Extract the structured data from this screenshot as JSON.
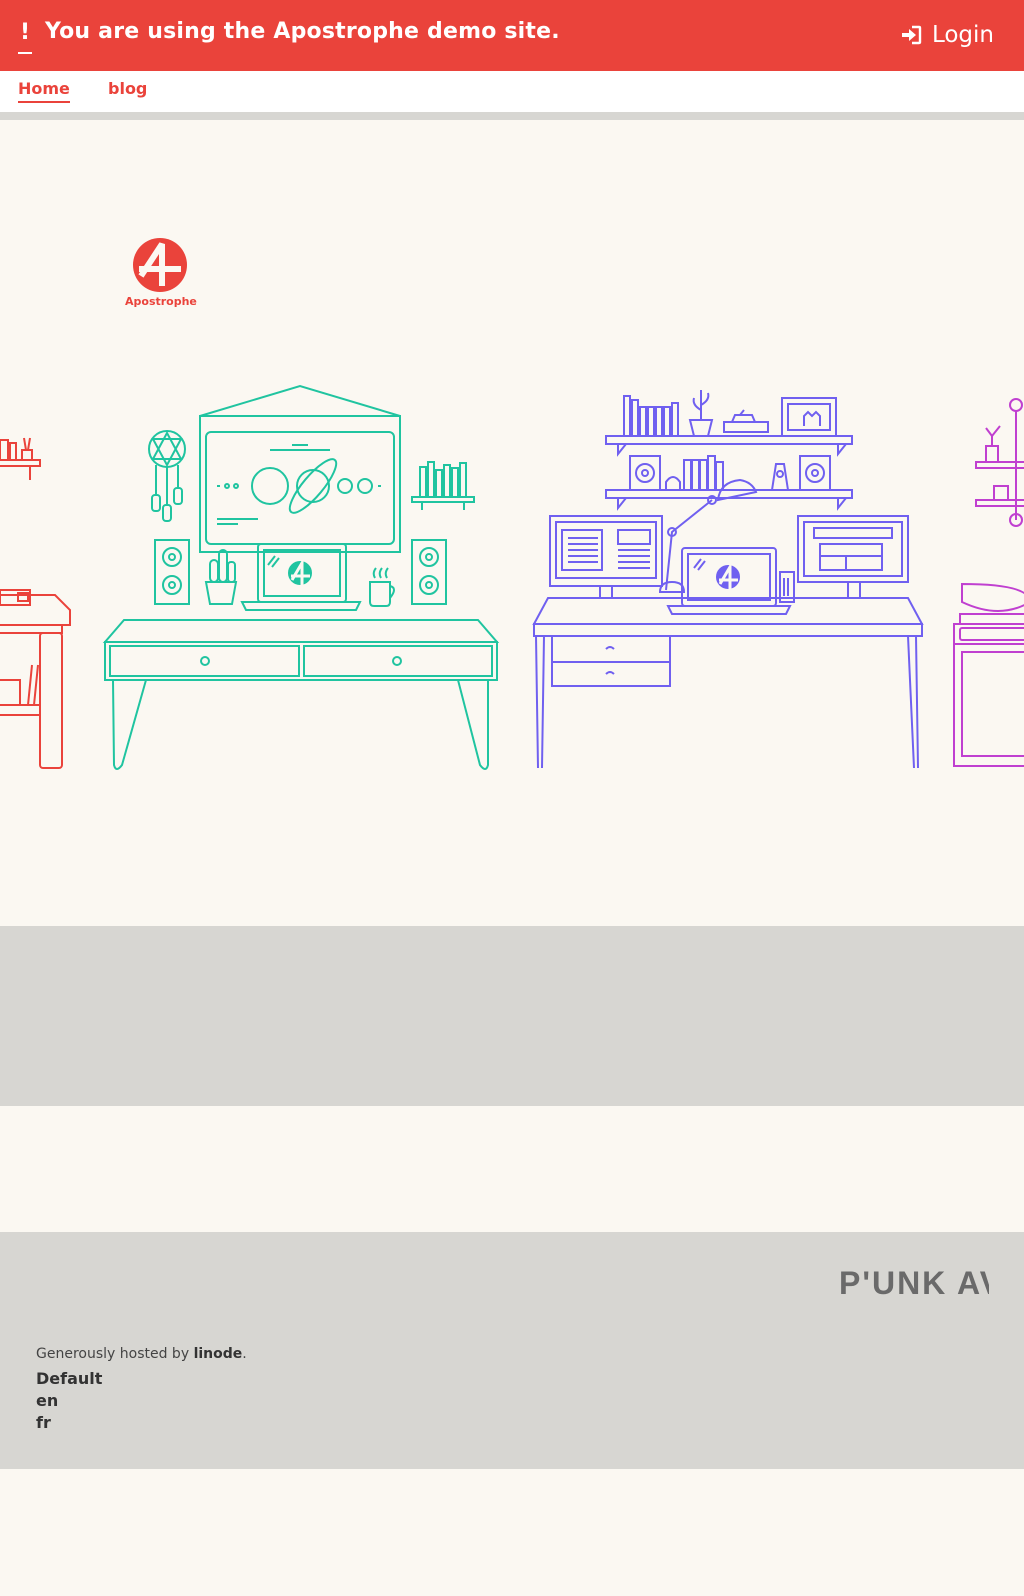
{
  "demo_bar": {
    "alert_glyph": "!",
    "message": "You are using the Apostrophe demo site.",
    "login_label": "Login",
    "login_icon": "sign-in-icon",
    "background": "#ea433b"
  },
  "nav": {
    "items": [
      {
        "label": "Home",
        "active": true
      },
      {
        "label": "blog",
        "active": false
      }
    ]
  },
  "hero": {
    "logo_word": "Apostrophe",
    "desk_colors": [
      "#ea433b",
      "#20c4a0",
      "#7060f0",
      "#c040d0"
    ]
  },
  "footer": {
    "brand": "P'UNK AVE",
    "hosted_prefix": "Generously hosted by ",
    "hosted_name": "linode",
    "hosted_suffix": ".",
    "links": [
      "Default",
      "en",
      "fr"
    ]
  }
}
